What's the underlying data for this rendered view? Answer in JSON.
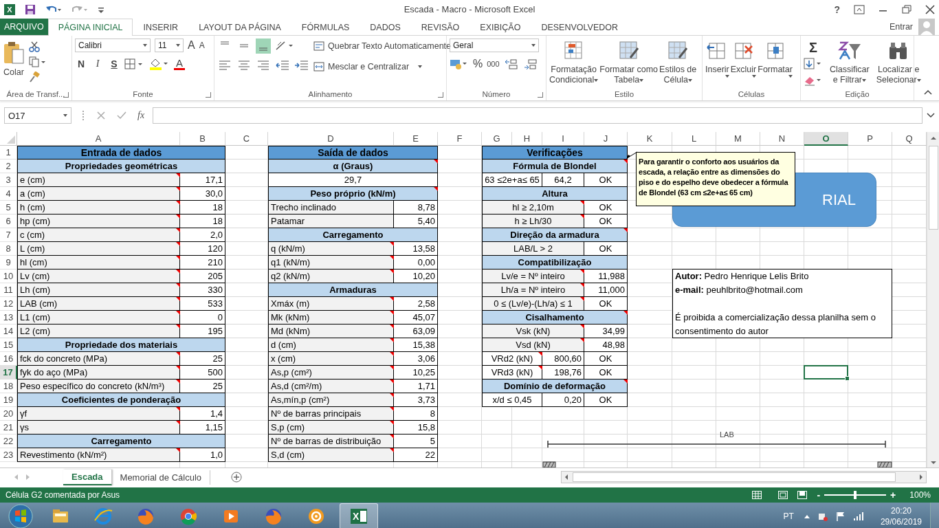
{
  "title_bar": {
    "logo": "X",
    "title": "Escada - Macro - Microsoft Excel",
    "help": "?"
  },
  "ribbon": {
    "tabs": [
      {
        "label": "ARQUIVO",
        "kind": "file",
        "selected": false
      },
      {
        "label": "PÁGINA INICIAL",
        "kind": "tab",
        "selected": true
      },
      {
        "label": "INSERIR",
        "kind": "tab",
        "selected": false
      },
      {
        "label": "LAYOUT DA PÁGINA",
        "kind": "tab",
        "selected": false
      },
      {
        "label": "FÓRMULAS",
        "kind": "tab",
        "selected": false
      },
      {
        "label": "DADOS",
        "kind": "tab",
        "selected": false
      },
      {
        "label": "REVISÃO",
        "kind": "tab",
        "selected": false
      },
      {
        "label": "EXIBIÇÃO",
        "kind": "tab",
        "selected": false
      },
      {
        "label": "DESENVOLVEDOR",
        "kind": "tab",
        "selected": false
      }
    ],
    "account": "Entrar",
    "clipboard": {
      "label": "Área de Transf...",
      "paste": "Colar"
    },
    "font": {
      "label": "Fonte",
      "family": "Calibri",
      "size": "11",
      "grow": "A",
      "shrink": "A",
      "styles": [
        "N",
        "I",
        "S"
      ],
      "color_letter": "A"
    },
    "alignment": {
      "label": "Alinhamento",
      "vertical": [
        {
          "selected": false
        },
        {
          "selected": false
        },
        {
          "selected": true
        }
      ],
      "wrap": "Quebrar Texto Automaticamente",
      "merge": "Mesclar e Centralizar"
    },
    "number": {
      "label": "Número",
      "format": "Geral",
      "percent": "%",
      "thousands": "000"
    },
    "styles": {
      "label": "Estilo",
      "buttons": [
        [
          "Formatação",
          "Condicional"
        ],
        [
          "Formatar como",
          "Tabela"
        ],
        [
          "Estilos de",
          "Célula"
        ]
      ]
    },
    "cells": {
      "label": "Células",
      "buttons": [
        "Inserir",
        "Excluir",
        "Formatar"
      ]
    },
    "editing": {
      "label": "Edição",
      "sum": "Σ",
      "buttons": [
        [
          "Classificar",
          "e Filtrar"
        ],
        [
          "Localizar e",
          "Selecionar"
        ]
      ]
    }
  },
  "formula_bar": {
    "name_box": "O17",
    "function_label": "fx"
  },
  "sheet": {
    "columns": [
      {
        "label": "A",
        "selected": false
      },
      {
        "label": "B",
        "selected": false
      },
      {
        "label": "C",
        "selected": false
      },
      {
        "label": "D",
        "selected": false
      },
      {
        "label": "E",
        "selected": false
      },
      {
        "label": "F",
        "selected": false
      },
      {
        "label": "G",
        "selected": false
      },
      {
        "label": "H",
        "selected": false
      },
      {
        "label": "I",
        "selected": false
      },
      {
        "label": "J",
        "selected": false
      },
      {
        "label": "K",
        "selected": false
      },
      {
        "label": "L",
        "selected": false
      },
      {
        "label": "M",
        "selected": false
      },
      {
        "label": "N",
        "selected": false
      },
      {
        "label": "O",
        "selected": true
      },
      {
        "label": "P",
        "selected": false
      },
      {
        "label": "Q",
        "selected": false
      }
    ],
    "rows": [
      {
        "label": "1",
        "selected": false
      },
      {
        "label": "2",
        "selected": false
      },
      {
        "label": "3",
        "selected": false
      },
      {
        "label": "4",
        "selected": false
      },
      {
        "label": "5",
        "selected": false
      },
      {
        "label": "6",
        "selected": false
      },
      {
        "label": "7",
        "selected": false
      },
      {
        "label": "8",
        "selected": false
      },
      {
        "label": "9",
        "selected": false
      },
      {
        "label": "10",
        "selected": false
      },
      {
        "label": "11",
        "selected": false
      },
      {
        "label": "12",
        "selected": false
      },
      {
        "label": "13",
        "selected": false
      },
      {
        "label": "14",
        "selected": false
      },
      {
        "label": "15",
        "selected": false
      },
      {
        "label": "16",
        "selected": false
      },
      {
        "label": "17",
        "selected": true
      },
      {
        "label": "18",
        "selected": false
      },
      {
        "label": "19",
        "selected": false
      },
      {
        "label": "20",
        "selected": false
      },
      {
        "label": "21",
        "selected": false
      },
      {
        "label": "22",
        "selected": false
      },
      {
        "label": "23",
        "selected": false
      }
    ],
    "blocks": [
      {
        "rows": [
          {
            "kind": "title",
            "cells": [
              {
                "kind": "text",
                "text": "Entrada de dados",
                "comment": false
              }
            ]
          },
          {
            "kind": "section",
            "cells": [
              {
                "kind": "text",
                "text": "Propriedades geométricas",
                "comment": false
              }
            ]
          },
          {
            "kind": "data",
            "cells": [
              {
                "kind": "label",
                "text": "e (cm)",
                "comment": true
              },
              {
                "kind": "number",
                "text": "17,1",
                "comment": false
              }
            ]
          },
          {
            "kind": "data",
            "cells": [
              {
                "kind": "label",
                "text": "a (cm)",
                "comment": true
              },
              {
                "kind": "number",
                "text": "30,0",
                "comment": false
              }
            ]
          },
          {
            "kind": "data",
            "cells": [
              {
                "kind": "label",
                "text": "h (cm)",
                "comment": true
              },
              {
                "kind": "number",
                "text": "18",
                "comment": false
              }
            ]
          },
          {
            "kind": "data",
            "cells": [
              {
                "kind": "label",
                "text": "hp (cm)",
                "comment": true
              },
              {
                "kind": "number",
                "text": "18",
                "comment": false
              }
            ]
          },
          {
            "kind": "data",
            "cells": [
              {
                "kind": "label",
                "text": "c (cm)",
                "comment": true
              },
              {
                "kind": "number",
                "text": "2,0",
                "comment": false
              }
            ]
          },
          {
            "kind": "data",
            "cells": [
              {
                "kind": "label",
                "text": "L (cm)",
                "comment": true
              },
              {
                "kind": "number",
                "text": "120",
                "comment": false
              }
            ]
          },
          {
            "kind": "data",
            "cells": [
              {
                "kind": "label",
                "text": "hl (cm)",
                "comment": true
              },
              {
                "kind": "number",
                "text": "210",
                "comment": false
              }
            ]
          },
          {
            "kind": "data",
            "cells": [
              {
                "kind": "label",
                "text": "Lv (cm)",
                "comment": true
              },
              {
                "kind": "number",
                "text": "205",
                "comment": false
              }
            ]
          },
          {
            "kind": "data",
            "cells": [
              {
                "kind": "label",
                "text": "Lh (cm)",
                "comment": true
              },
              {
                "kind": "number",
                "text": "330",
                "comment": false
              }
            ]
          },
          {
            "kind": "data",
            "cells": [
              {
                "kind": "label",
                "text": "LAB (cm)",
                "comment": true
              },
              {
                "kind": "number",
                "text": "533",
                "comment": false
              }
            ]
          },
          {
            "kind": "data",
            "cells": [
              {
                "kind": "label",
                "text": "L1 (cm)",
                "comment": true
              },
              {
                "kind": "number",
                "text": "0",
                "comment": false
              }
            ]
          },
          {
            "kind": "data",
            "cells": [
              {
                "kind": "label",
                "text": "L2 (cm)",
                "comment": true
              },
              {
                "kind": "number",
                "text": "195",
                "comment": false
              }
            ]
          },
          {
            "kind": "section",
            "cells": [
              {
                "kind": "text",
                "text": "Propriedade dos materiais",
                "comment": false
              }
            ]
          },
          {
            "kind": "data",
            "cells": [
              {
                "kind": "label",
                "text": "fck do concreto (MPa)",
                "comment": true
              },
              {
                "kind": "number",
                "text": "25",
                "comment": false
              }
            ]
          },
          {
            "kind": "data",
            "cells": [
              {
                "kind": "label",
                "text": "fyk do aço (MPa)",
                "comment": true
              },
              {
                "kind": "number",
                "text": "500",
                "comment": false
              }
            ]
          },
          {
            "kind": "data",
            "cells": [
              {
                "kind": "label",
                "text": "Peso específico do concreto (kN/m³)",
                "comment": true
              },
              {
                "kind": "number",
                "text": "25",
                "comment": false
              }
            ]
          },
          {
            "kind": "section",
            "cells": [
              {
                "kind": "text",
                "text": "Coeficientes de ponderação",
                "comment": false
              }
            ]
          },
          {
            "kind": "data",
            "cells": [
              {
                "kind": "label",
                "text": "γf",
                "comment": true
              },
              {
                "kind": "number",
                "text": "1,4",
                "comment": false
              }
            ]
          },
          {
            "kind": "data",
            "cells": [
              {
                "kind": "label",
                "text": "γs",
                "comment": true
              },
              {
                "kind": "number",
                "text": "1,15",
                "comment": false
              }
            ]
          },
          {
            "kind": "section",
            "cells": [
              {
                "kind": "text",
                "text": "Carregamento",
                "comment": false
              }
            ]
          },
          {
            "kind": "data",
            "cells": [
              {
                "kind": "label",
                "text": "Revestimento (kN/m²)",
                "comment": true
              },
              {
                "kind": "number",
                "text": "1,0",
                "comment": false
              }
            ]
          }
        ]
      },
      {
        "rows": [
          {
            "kind": "title",
            "cells": [
              {
                "kind": "text",
                "text": "Saída de dados",
                "comment": false
              }
            ]
          },
          {
            "kind": "section",
            "cells": [
              {
                "kind": "text",
                "text": "α (Graus)",
                "comment": true
              }
            ]
          },
          {
            "kind": "data",
            "cells": [
              {
                "kind": "text",
                "text": "29,7",
                "comment": false
              }
            ]
          },
          {
            "kind": "section",
            "cells": [
              {
                "kind": "text",
                "text": "Peso próprio (kN/m)",
                "comment": true
              }
            ]
          },
          {
            "kind": "data",
            "cells": [
              {
                "kind": "label",
                "text": "Trecho inclinado",
                "comment": false
              },
              {
                "kind": "number",
                "text": "8,78",
                "comment": false
              }
            ]
          },
          {
            "kind": "data",
            "cells": [
              {
                "kind": "label",
                "text": "Patamar",
                "comment": false
              },
              {
                "kind": "number",
                "text": "5,40",
                "comment": false
              }
            ]
          },
          {
            "kind": "section",
            "cells": [
              {
                "kind": "text",
                "text": "Carregamento",
                "comment": false
              }
            ]
          },
          {
            "kind": "data",
            "cells": [
              {
                "kind": "label",
                "text": "q (kN/m)",
                "comment": true
              },
              {
                "kind": "number",
                "text": "13,58",
                "comment": false
              }
            ]
          },
          {
            "kind": "data",
            "cells": [
              {
                "kind": "label",
                "text": "q1 (kN/m)",
                "comment": true
              },
              {
                "kind": "number",
                "text": "0,00",
                "comment": false
              }
            ]
          },
          {
            "kind": "data",
            "cells": [
              {
                "kind": "label",
                "text": "q2 (kN/m)",
                "comment": true
              },
              {
                "kind": "number",
                "text": "10,20",
                "comment": false
              }
            ]
          },
          {
            "kind": "section",
            "cells": [
              {
                "kind": "text",
                "text": "Armaduras",
                "comment": false
              }
            ]
          },
          {
            "kind": "data",
            "cells": [
              {
                "kind": "label",
                "text": "Xmáx (m)",
                "comment": true
              },
              {
                "kind": "number",
                "text": "2,58",
                "comment": false
              }
            ]
          },
          {
            "kind": "data",
            "cells": [
              {
                "kind": "label",
                "text": "Mk (kNm)",
                "comment": true
              },
              {
                "kind": "number",
                "text": "45,07",
                "comment": false
              }
            ]
          },
          {
            "kind": "data",
            "cells": [
              {
                "kind": "label",
                "text": "Md (kNm)",
                "comment": true
              },
              {
                "kind": "number",
                "text": "63,09",
                "comment": false
              }
            ]
          },
          {
            "kind": "data",
            "cells": [
              {
                "kind": "label",
                "text": "d (cm)",
                "comment": true
              },
              {
                "kind": "number",
                "text": "15,38",
                "comment": false
              }
            ]
          },
          {
            "kind": "data",
            "cells": [
              {
                "kind": "label",
                "text": "x (cm)",
                "comment": true
              },
              {
                "kind": "number",
                "text": "3,06",
                "comment": false
              }
            ]
          },
          {
            "kind": "data",
            "cells": [
              {
                "kind": "label",
                "text": "As,p (cm²)",
                "comment": true
              },
              {
                "kind": "number",
                "text": "10,25",
                "comment": false
              }
            ]
          },
          {
            "kind": "data",
            "cells": [
              {
                "kind": "label",
                "text": "As,d (cm²/m)",
                "comment": true
              },
              {
                "kind": "number",
                "text": "1,71",
                "comment": false
              }
            ]
          },
          {
            "kind": "data",
            "cells": [
              {
                "kind": "label",
                "text": "As,mín,p (cm²)",
                "comment": true
              },
              {
                "kind": "number",
                "text": "3,73",
                "comment": false
              }
            ]
          },
          {
            "kind": "data",
            "cells": [
              {
                "kind": "label",
                "text": "Nº de barras principais",
                "comment": true
              },
              {
                "kind": "number",
                "text": "8",
                "comment": false
              }
            ]
          },
          {
            "kind": "data",
            "cells": [
              {
                "kind": "label",
                "text": "S,p (cm)",
                "comment": true
              },
              {
                "kind": "number",
                "text": "15,8",
                "comment": false
              }
            ]
          },
          {
            "kind": "data",
            "cells": [
              {
                "kind": "label",
                "text": "Nº de barras de distribuição",
                "comment": true
              },
              {
                "kind": "number",
                "text": "5",
                "comment": false
              }
            ]
          },
          {
            "kind": "data",
            "cells": [
              {
                "kind": "label",
                "text": "S,d (cm)",
                "comment": true
              },
              {
                "kind": "number",
                "text": "22",
                "comment": false
              }
            ]
          }
        ]
      },
      {
        "rows": [
          {
            "kind": "title",
            "cells": [
              {
                "kind": "text",
                "text": "Verificações",
                "comment": false
              }
            ]
          },
          {
            "kind": "section",
            "cells": [
              {
                "kind": "text",
                "text": "Fórmula de Blondel",
                "comment": true
              }
            ]
          },
          {
            "kind": "data",
            "cells": [
              {
                "kind": "text",
                "text": "63 ≤2e+a≤ 65",
                "comment": false
              },
              {
                "kind": "text",
                "text": "64,2",
                "comment": false
              },
              {
                "kind": "text",
                "text": "OK",
                "comment": false
              }
            ]
          },
          {
            "kind": "section",
            "cells": [
              {
                "kind": "text",
                "text": "Altura",
                "comment": false
              }
            ]
          },
          {
            "kind": "data",
            "cells": [
              {
                "kind": "label",
                "text": "hl ≥ 2,10m",
                "comment": true
              },
              {
                "kind": "text",
                "text": "OK",
                "comment": false
              }
            ]
          },
          {
            "kind": "data",
            "cells": [
              {
                "kind": "label",
                "text": "h ≥ Lh/30",
                "comment": true
              },
              {
                "kind": "text",
                "text": "OK",
                "comment": false
              }
            ]
          },
          {
            "kind": "section",
            "cells": [
              {
                "kind": "text",
                "text": "Direção da armadura",
                "comment": true
              }
            ]
          },
          {
            "kind": "data",
            "cells": [
              {
                "kind": "label",
                "text": "LAB/L > 2",
                "comment": false
              },
              {
                "kind": "text",
                "text": "OK",
                "comment": false
              }
            ]
          },
          {
            "kind": "section",
            "cells": [
              {
                "kind": "text",
                "text": "Compatibilização",
                "comment": false
              }
            ]
          },
          {
            "kind": "data",
            "cells": [
              {
                "kind": "label",
                "text": "Lv/e = Nº inteiro",
                "comment": true
              },
              {
                "kind": "number",
                "text": "11,988",
                "comment": false
              }
            ]
          },
          {
            "kind": "data",
            "cells": [
              {
                "kind": "label",
                "text": "Lh/a = Nº inteiro",
                "comment": true
              },
              {
                "kind": "number",
                "text": "11,000",
                "comment": false
              }
            ]
          },
          {
            "kind": "data",
            "cells": [
              {
                "kind": "label",
                "text": "0 ≤ (Lv/e)-(Lh/a) ≤ 1",
                "comment": true
              },
              {
                "kind": "text",
                "text": "OK",
                "comment": false
              }
            ]
          },
          {
            "kind": "section",
            "cells": [
              {
                "kind": "text",
                "text": "Cisalhamento",
                "comment": true
              }
            ]
          },
          {
            "kind": "data",
            "cells": [
              {
                "kind": "label",
                "text": "Vsk (kN)",
                "comment": true
              },
              {
                "kind": "number",
                "text": "34,99",
                "comment": false
              }
            ]
          },
          {
            "kind": "data",
            "cells": [
              {
                "kind": "label",
                "text": "Vsd (kN)",
                "comment": true
              },
              {
                "kind": "number",
                "text": "48,98",
                "comment": false
              }
            ]
          },
          {
            "kind": "data",
            "cells": [
              {
                "kind": "text",
                "text": "VRd2 (kN)",
                "comment": true
              },
              {
                "kind": "number",
                "text": "800,60",
                "comment": false
              },
              {
                "kind": "text",
                "text": "OK",
                "comment": false
              }
            ]
          },
          {
            "kind": "data",
            "cells": [
              {
                "kind": "text",
                "text": "VRd3 (kN)",
                "comment": true
              },
              {
                "kind": "number",
                "text": "198,76",
                "comment": false
              },
              {
                "kind": "text",
                "text": "OK",
                "comment": false
              }
            ]
          },
          {
            "kind": "section",
            "cells": [
              {
                "kind": "text",
                "text": "Domínio de deformação",
                "comment": true
              }
            ]
          },
          {
            "kind": "data",
            "cells": [
              {
                "kind": "text",
                "text": "x/d ≤ 0,45",
                "comment": false
              },
              {
                "kind": "number",
                "text": "0,20",
                "comment": false
              },
              {
                "kind": "text",
                "text": "OK",
                "comment": false
              }
            ]
          }
        ]
      }
    ],
    "comment": "Para garantir o conforto aos usuários da escada, a relação entre as dimensões do piso e do espelho deve obedecer a fórmula de Blondel (63 cm ≤2e+a≤ 65 cm)",
    "shape_button": "RIAL",
    "author_note": [
      "**Autor:** Pedro Henrique Lelis Brito",
      "**e-mail:** peuhlbrito@hotmail.com",
      "É proibida a comercialização dessa planilha sem o consentimento do autor"
    ],
    "dimension_label": "LAB"
  },
  "sheet_tabs": [
    {
      "label": "Escada",
      "selected": true
    },
    {
      "label": "Memorial de Cálculo",
      "selected": false
    }
  ],
  "status_bar": {
    "message": "Célula G2 comentada por Asus",
    "zoom_out": "-",
    "zoom_in": "+",
    "zoom": "100%",
    "level": 0.5
  },
  "taskbar": {
    "apps": [
      {
        "kind": "folder",
        "selected": false
      },
      {
        "kind": "browser-e",
        "selected": false
      },
      {
        "kind": "fox",
        "selected": false
      },
      {
        "kind": "chrome",
        "selected": false
      },
      {
        "kind": "media",
        "selected": false
      },
      {
        "kind": "fox",
        "selected": false
      },
      {
        "kind": "wheel",
        "selected": false
      },
      {
        "kind": "excel",
        "selected": true,
        "label": "X"
      }
    ],
    "language": "PT",
    "time": "20:20",
    "date": "29/06/2019"
  }
}
